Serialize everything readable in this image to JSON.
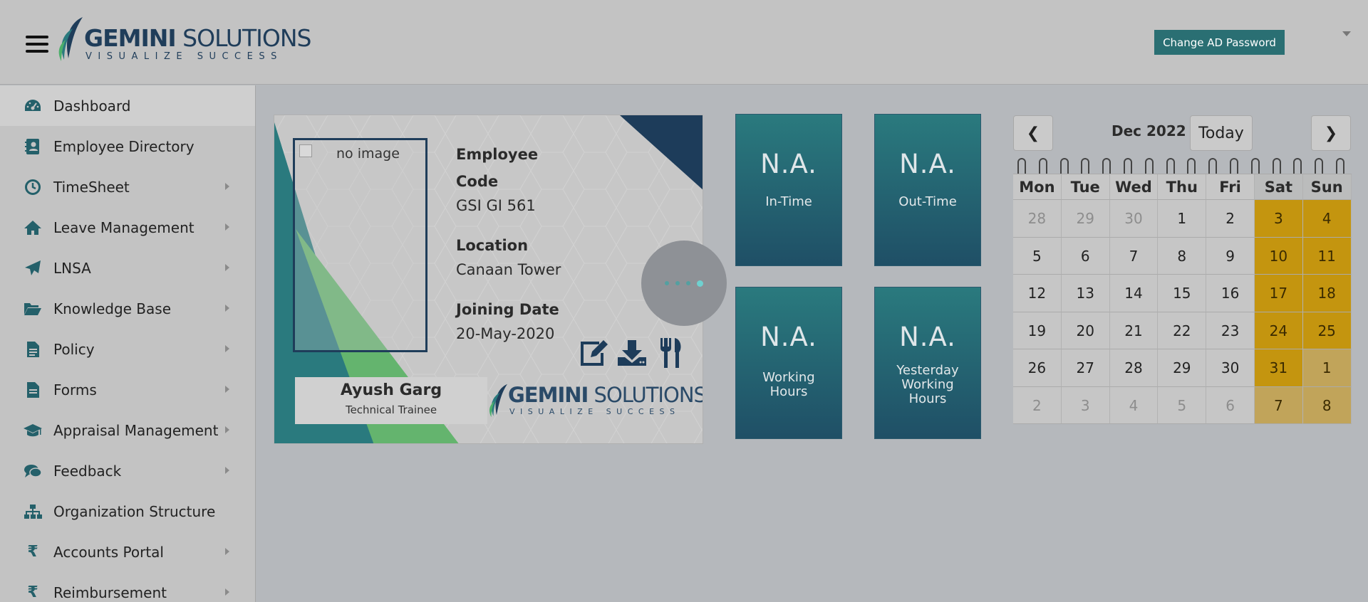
{
  "header": {
    "logo_main": "GEMINI",
    "logo_second": " SOLUTIONS",
    "logo_tagline": "VISUALIZE SUCCESS",
    "change_password_label": "Change AD Password"
  },
  "sidebar": {
    "items": [
      {
        "label": "Dashboard",
        "icon": "dashboard-icon"
      },
      {
        "label": "Employee Directory",
        "icon": "directory-icon"
      },
      {
        "label": "TimeSheet",
        "icon": "clock-icon"
      },
      {
        "label": "Leave Management",
        "icon": "home-icon"
      },
      {
        "label": "LNSA",
        "icon": "paper-plane-icon"
      },
      {
        "label": "Knowledge Base",
        "icon": "folder-open-icon"
      },
      {
        "label": "Policy",
        "icon": "document-icon"
      },
      {
        "label": "Forms",
        "icon": "form-icon"
      },
      {
        "label": "Appraisal Management",
        "icon": "graduation-cap-icon"
      },
      {
        "label": "Feedback",
        "icon": "comments-icon"
      },
      {
        "label": "Organization Structure",
        "icon": "sitemap-icon"
      },
      {
        "label": "Accounts Portal",
        "icon": "rupee-icon"
      },
      {
        "label": "Reimbursement",
        "icon": "rupee-icon"
      }
    ]
  },
  "idcard": {
    "photo_alt": "no image",
    "employee_code_label_1": "Employee",
    "employee_code_label_2": "Code",
    "employee_code": "GSI GI 561",
    "location_label": "Location",
    "location": "Canaan Tower",
    "joining_label": "Joining Date",
    "joining_date": "20-May-2020",
    "name": "Ayush Garg",
    "designation": "Technical Trainee",
    "logo_main": "GEMINI",
    "logo_second": " SOLUTIONS",
    "logo_tagline": "VISUALIZE SUCCESS"
  },
  "tiles": {
    "in_time": {
      "value": "N.A.",
      "label": "In-Time"
    },
    "out_time": {
      "value": "N.A.",
      "label": "Out-Time"
    },
    "working_hours": {
      "value": "N.A.",
      "label_1": "Working",
      "label_2": "Hours"
    },
    "yesterday_hours": {
      "value": "N.A.",
      "label_1": "Yesterday",
      "label_2": "Working",
      "label_3": "Hours"
    }
  },
  "calendar": {
    "prev_label": "❮",
    "next_label": "❯",
    "title": "Dec 2022",
    "today_label": "Today",
    "weekdays": [
      "Mon",
      "Tue",
      "Wed",
      "Thu",
      "Fri",
      "Sat",
      "Sun"
    ],
    "weeks": [
      [
        "28",
        "29",
        "30",
        "1",
        "2",
        "3",
        "4"
      ],
      [
        "5",
        "6",
        "7",
        "8",
        "9",
        "10",
        "11"
      ],
      [
        "12",
        "13",
        "14",
        "15",
        "16",
        "17",
        "18"
      ],
      [
        "19",
        "20",
        "21",
        "22",
        "23",
        "24",
        "25"
      ],
      [
        "26",
        "27",
        "28",
        "29",
        "30",
        "31",
        "1"
      ],
      [
        "2",
        "3",
        "4",
        "5",
        "6",
        "7",
        "8"
      ]
    ],
    "other_month": [
      [
        true,
        true,
        true,
        false,
        false,
        false,
        false
      ],
      [
        false,
        false,
        false,
        false,
        false,
        false,
        false
      ],
      [
        false,
        false,
        false,
        false,
        false,
        false,
        false
      ],
      [
        false,
        false,
        false,
        false,
        false,
        false,
        false
      ],
      [
        false,
        false,
        false,
        false,
        false,
        false,
        true
      ],
      [
        true,
        true,
        true,
        true,
        true,
        true,
        true
      ]
    ],
    "weekend_color": "#c4950f"
  }
}
